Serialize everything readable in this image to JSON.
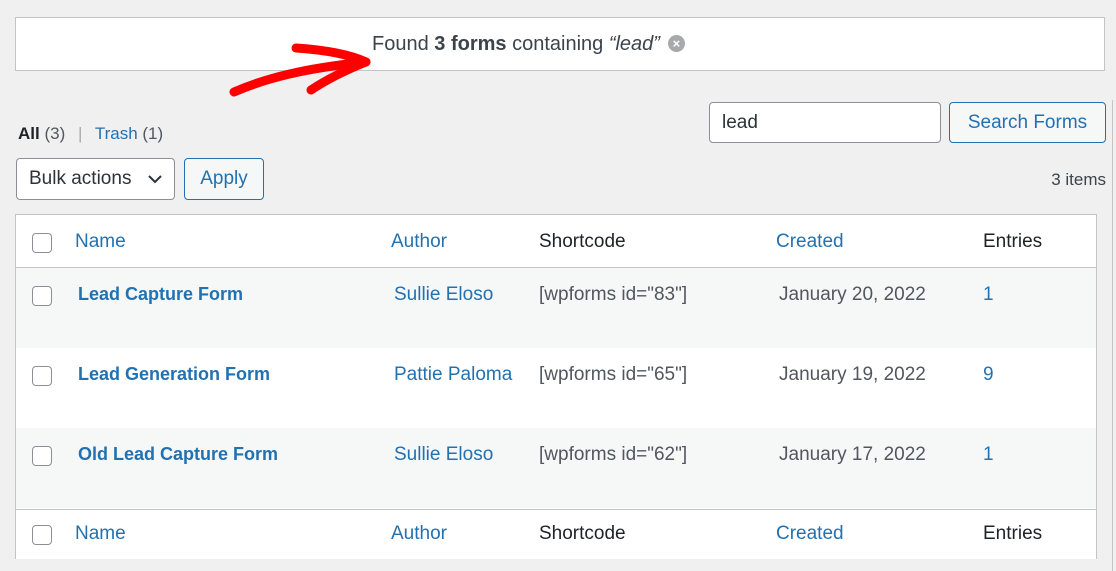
{
  "notice": {
    "prefix": "Found ",
    "count_bold": "3 forms",
    "middle": " containing ",
    "query_italic": "“lead”",
    "clear_icon": "×"
  },
  "views": {
    "all_label": "All",
    "all_count": "(3)",
    "separator": "|",
    "trash_label": "Trash",
    "trash_count": "(1)"
  },
  "search": {
    "value": "lead",
    "button_label": "Search Forms"
  },
  "bulk": {
    "selected": "Bulk actions",
    "apply_label": "Apply"
  },
  "items_count": "3 items",
  "table": {
    "columns": {
      "name": "Name",
      "author": "Author",
      "shortcode": "Shortcode",
      "created": "Created",
      "entries": "Entries"
    },
    "rows": [
      {
        "name": "Lead Capture Form",
        "author": "Sullie Eloso",
        "shortcode": "[wpforms id=\"83\"]",
        "created": "January 20, 2022",
        "entries": "1"
      },
      {
        "name": "Lead Generation Form",
        "author": "Pattie Paloma",
        "shortcode": "[wpforms id=\"65\"]",
        "created": "January 19, 2022",
        "entries": "9"
      },
      {
        "name": "Old Lead Capture Form",
        "author": "Sullie Eloso",
        "shortcode": "[wpforms id=\"62\"]",
        "created": "January 17, 2022",
        "entries": "1"
      }
    ]
  },
  "colors": {
    "link": "#2271b1",
    "annotation_arrow": "#ff0000",
    "background": "#f0f0f1"
  }
}
